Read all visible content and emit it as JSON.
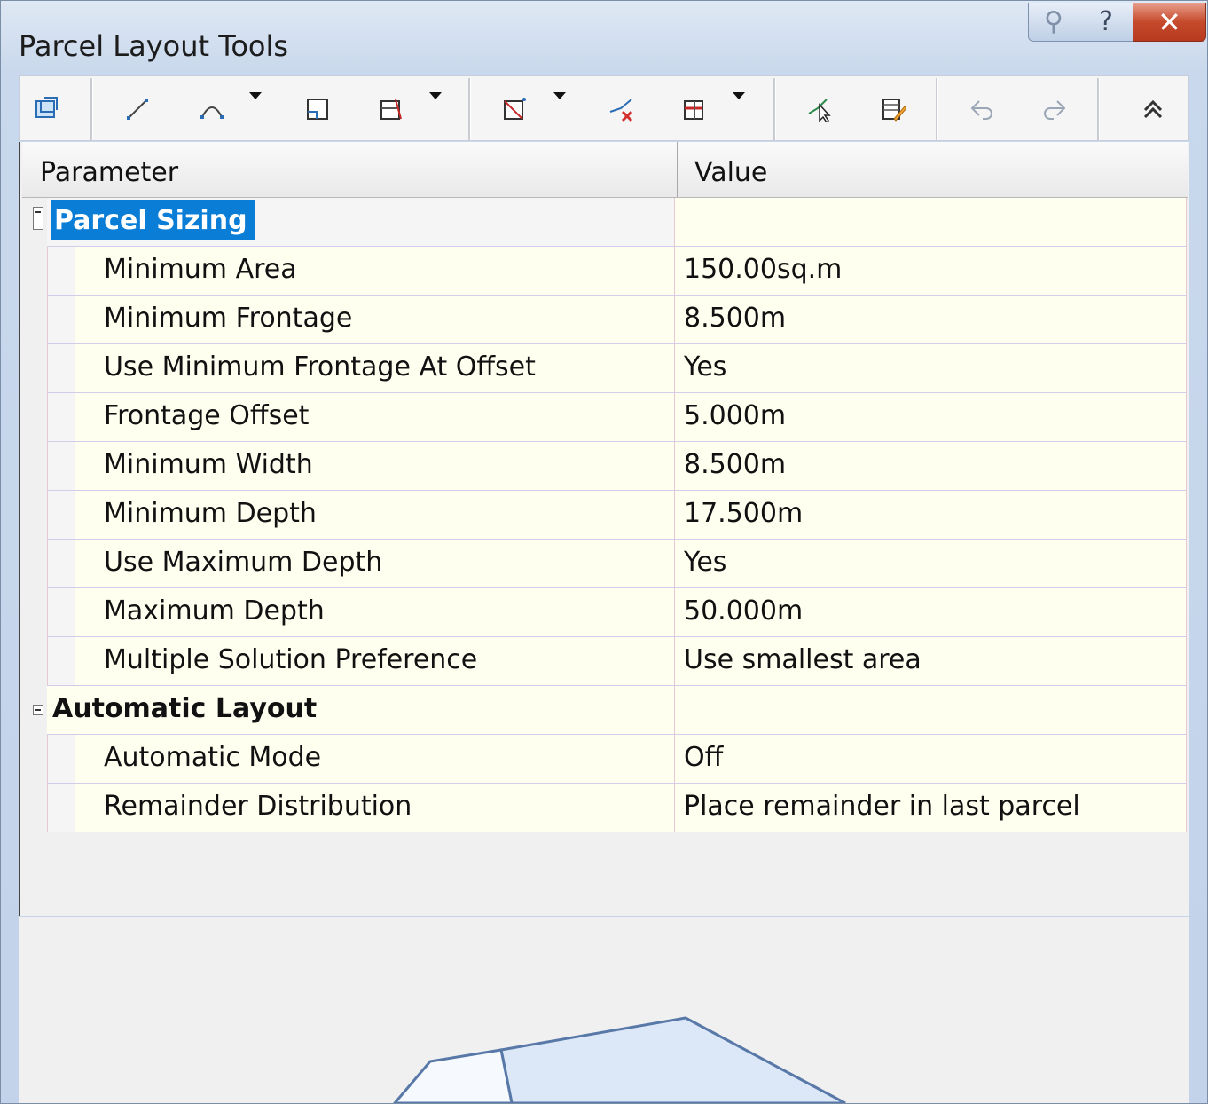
{
  "window": {
    "title": "Parcel Layout Tools",
    "buttons": {
      "pin": "⚲",
      "help": "?",
      "close": "✕"
    }
  },
  "toolbar": {
    "tools": [
      {
        "name": "select-lot-icon"
      },
      {
        "name": "line-icon"
      },
      {
        "name": "arc-icon"
      },
      {
        "name": "parcel-icon"
      },
      {
        "name": "slide-line-icon"
      },
      {
        "name": "swing-line-icon"
      },
      {
        "name": "delete-vertex-icon"
      },
      {
        "name": "delete-sub-entity-icon"
      },
      {
        "name": "pick-sub-entity-icon"
      },
      {
        "name": "edit-properties-icon"
      },
      {
        "name": "undo-icon"
      },
      {
        "name": "redo-icon"
      },
      {
        "name": "collapse-icon"
      }
    ]
  },
  "grid": {
    "headers": {
      "parameter": "Parameter",
      "value": "Value"
    },
    "categories": [
      {
        "label": "Parcel Sizing",
        "selected": true,
        "rows": [
          {
            "parameter": "Minimum Area",
            "value": "150.00sq.m"
          },
          {
            "parameter": "Minimum Frontage",
            "value": "8.500m"
          },
          {
            "parameter": "Use Minimum Frontage At Offset",
            "value": "Yes"
          },
          {
            "parameter": "Frontage Offset",
            "value": "5.000m"
          },
          {
            "parameter": "Minimum Width",
            "value": "8.500m"
          },
          {
            "parameter": "Minimum Depth",
            "value": "17.500m"
          },
          {
            "parameter": "Use Maximum Depth",
            "value": "Yes"
          },
          {
            "parameter": "Maximum Depth",
            "value": "50.000m"
          },
          {
            "parameter": "Multiple Solution Preference",
            "value": "Use smallest area"
          }
        ]
      },
      {
        "label": "Automatic Layout",
        "selected": false,
        "rows": [
          {
            "parameter": "Automatic Mode",
            "value": "Off"
          },
          {
            "parameter": "Remainder Distribution",
            "value": "Place remainder in last parcel"
          }
        ]
      }
    ]
  },
  "colors": {
    "selection": "#0a7ed6",
    "row_bg": "#fffff0",
    "parcel_fill": "#dce8f8",
    "parcel_stroke": "#5878a8"
  }
}
